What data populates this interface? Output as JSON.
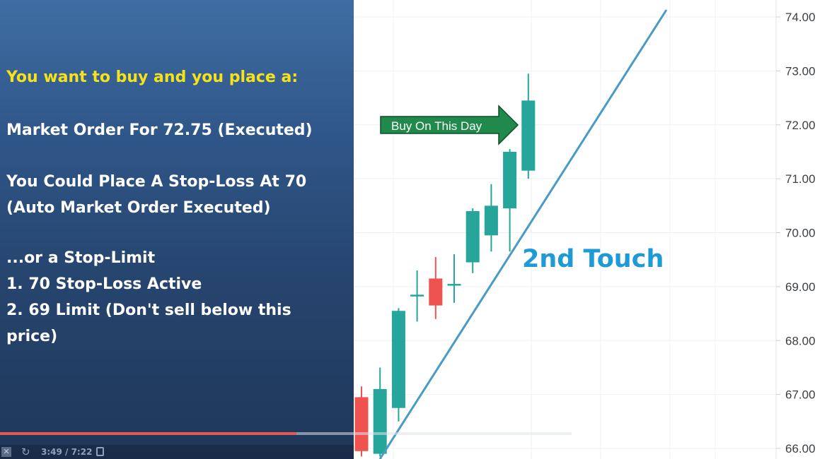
{
  "left_panel": {
    "headline": "You want to buy and you place a:",
    "lines": [
      "Market Order For 72.75 (Executed)",
      "You Could Place A Stop-Loss At 70",
      "(Auto Market Order Executed)",
      "...or a Stop-Limit",
      "1. 70 Stop-Loss Active",
      "2. 69 Limit (Don't sell below this",
      "price)"
    ]
  },
  "annotations": {
    "arrow_label": "Buy On This Day",
    "touch_label": "2nd Touch"
  },
  "video_player": {
    "time": "3:49 / 7:22",
    "progress": 0.519
  },
  "colors": {
    "bullish": "#26a69a",
    "bearish": "#ef5350",
    "trendline": "#4a9bc4",
    "touch_text": "#1e9ad6",
    "arrow_fill": "#1f8a4c",
    "headline": "#f5e21a"
  },
  "chart_data": {
    "type": "candlestick",
    "yticks": [
      "74.00",
      "73.00",
      "72.00",
      "71.00",
      "70.00",
      "69.00",
      "68.00",
      "67.00",
      "66.00"
    ],
    "ylim": [
      66.0,
      74.0
    ],
    "candles": [
      {
        "open": 66.95,
        "high": 67.15,
        "low": 65.85,
        "close": 65.95
      },
      {
        "open": 65.9,
        "high": 67.5,
        "low": 65.85,
        "close": 67.1
      },
      {
        "open": 66.75,
        "high": 68.6,
        "low": 66.5,
        "close": 68.55
      },
      {
        "open": 68.85,
        "high": 69.3,
        "low": 68.35,
        "close": 68.85
      },
      {
        "open": 69.15,
        "high": 69.55,
        "low": 68.4,
        "close": 68.65
      },
      {
        "open": 69.05,
        "high": 69.6,
        "low": 68.7,
        "close": 69.05
      },
      {
        "open": 69.45,
        "high": 70.45,
        "low": 69.25,
        "close": 70.4
      },
      {
        "open": 69.95,
        "high": 70.9,
        "low": 69.65,
        "close": 70.5
      },
      {
        "open": 70.45,
        "high": 71.55,
        "low": 69.65,
        "close": 71.5
      },
      {
        "open": 71.15,
        "high": 72.95,
        "low": 71.0,
        "close": 72.45
      }
    ]
  }
}
